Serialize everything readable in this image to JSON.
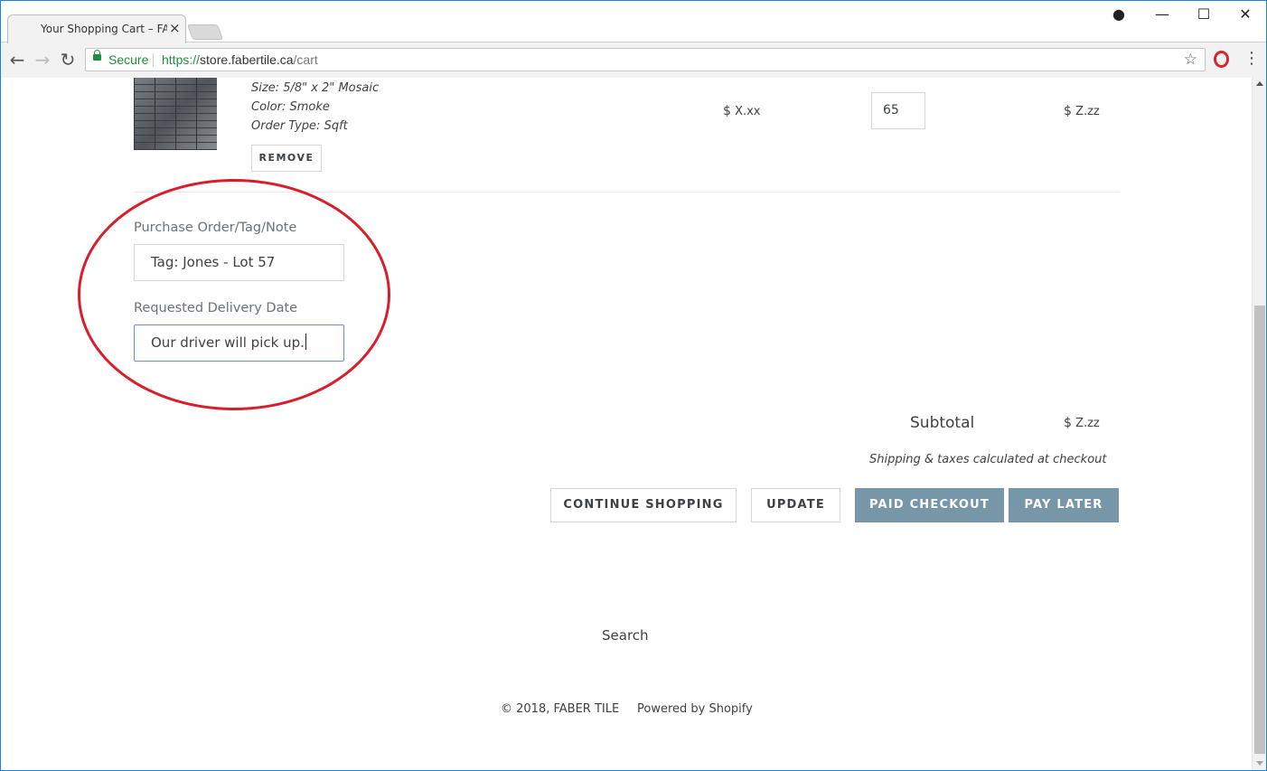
{
  "browser": {
    "tab_title": "Your Shopping Cart – FABER TILE",
    "tab_close": "×",
    "window_controls": {
      "minimize": "—",
      "maximize": "☐",
      "close": "✕",
      "profile": "●"
    },
    "nav": {
      "back": "←",
      "forward": "→",
      "reload": "↻"
    },
    "secure_label": "Secure",
    "url_scheme": "https://",
    "url_host": "store.fabertile.ca",
    "url_path": "/cart",
    "bookmark_star": "☆",
    "menu": "⋮"
  },
  "cart_item": {
    "thumbnail": "tile-mosaic-thumbnail",
    "size": "Size: 5/8\" x 2\" Mosaic",
    "color": "Color: Smoke",
    "order_type": "Order Type: Sqft",
    "remove_label": "REMOVE",
    "price_currency": "$",
    "price": "X.xx",
    "quantity": "65",
    "total_currency": "$",
    "total": "Z.zz"
  },
  "notes": {
    "po_label": "Purchase Order/Tag/Note",
    "po_value": "Tag: Jones - Lot 57",
    "delivery_label": "Requested Delivery Date",
    "delivery_value": "Our driver will pick up."
  },
  "summary": {
    "subtotal_label": "Subtotal",
    "subtotal_currency": "$",
    "subtotal_value": "Z.zz",
    "shipping_note": "Shipping & taxes calculated at checkout"
  },
  "actions": {
    "continue_shopping": "CONTINUE SHOPPING",
    "update": "UPDATE",
    "paid_checkout": "PAID CHECKOUT",
    "pay_later": "PAY LATER"
  },
  "footer": {
    "search": "Search",
    "copyright": "© 2018, FABER TILE",
    "powered_by": "Powered by Shopify"
  },
  "colors": {
    "accent_button": "#7796a8",
    "annotation": "#d91e2b",
    "secure_green": "#1e8e3e"
  }
}
